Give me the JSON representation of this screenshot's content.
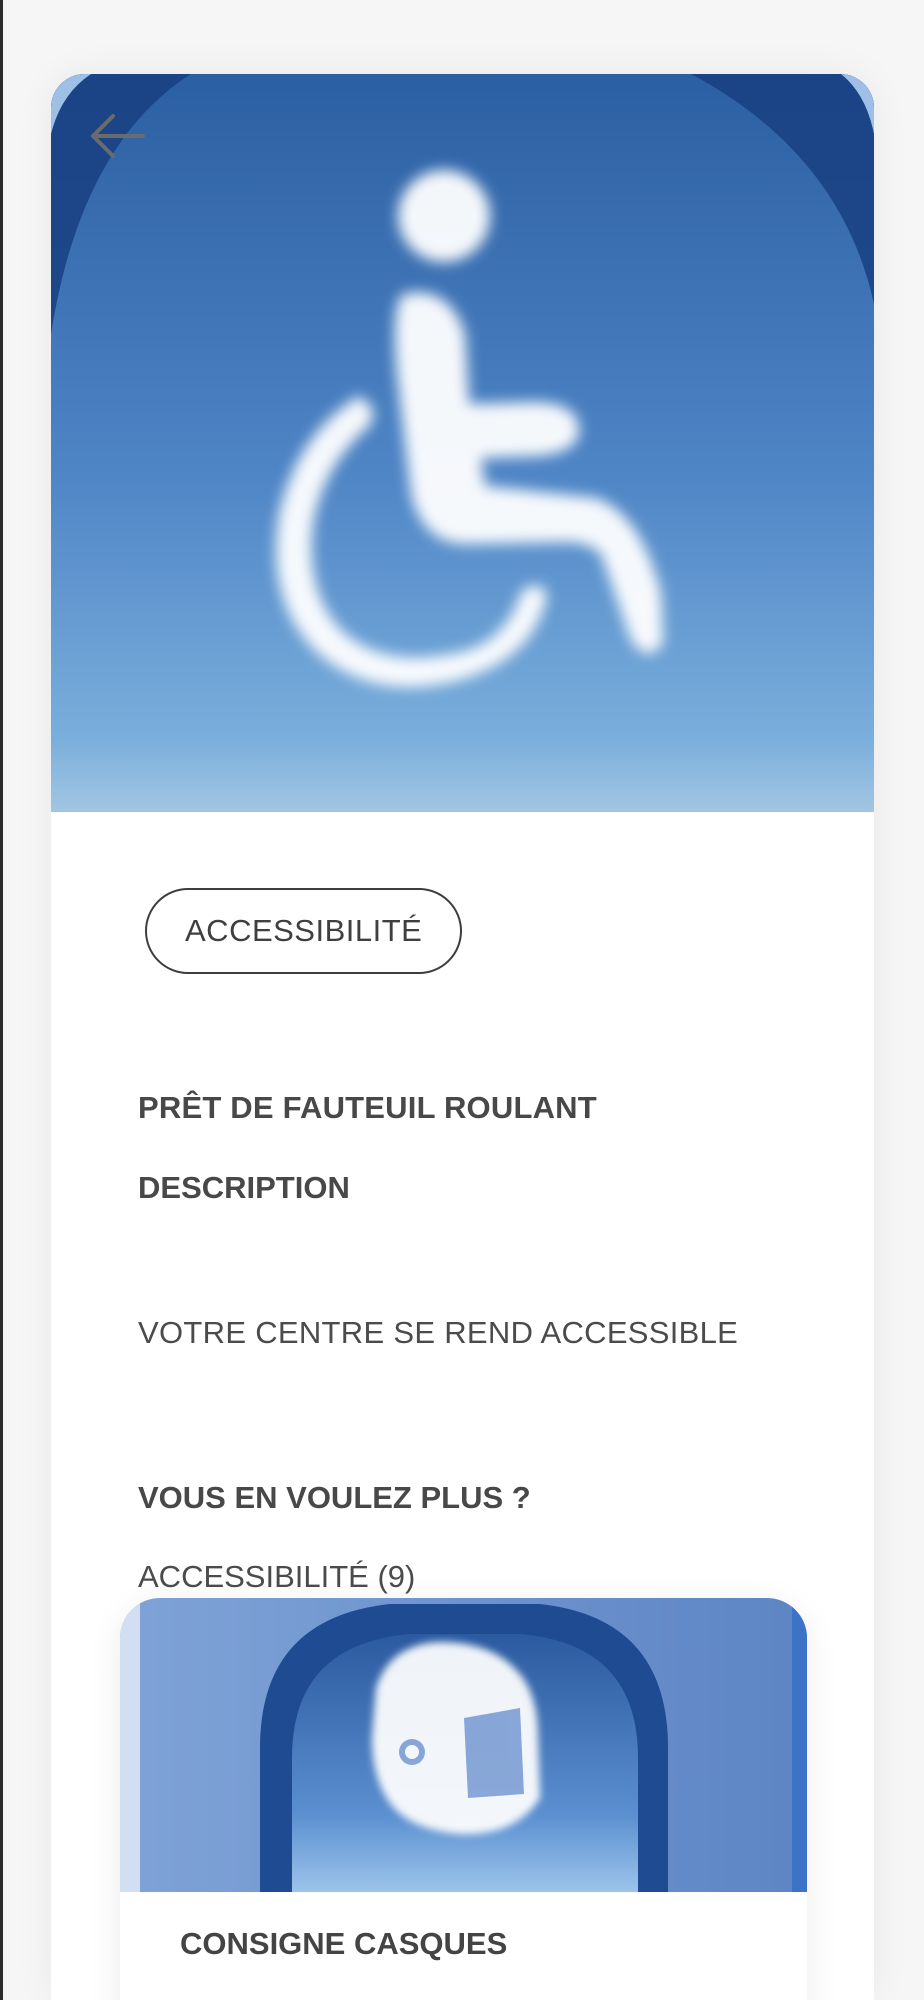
{
  "header": {
    "back_icon": "arrow-left-icon",
    "hero_image": "wheelchair-cloud-sky-image"
  },
  "item": {
    "category": "ACCESSIBILITÉ",
    "title": "PRÊT DE FAUTEUIL ROULANT",
    "description_heading": "DESCRIPTION",
    "description_text": "VOTRE CENTRE SE REND ACCESSIBLE"
  },
  "more": {
    "heading": "VOUS EN VOULEZ PLUS ?",
    "link_label": "ACCESSIBILITÉ (9)"
  },
  "related": [
    {
      "title": "CONSIGNE CASQUES",
      "image": "helmet-cloud-arch-image"
    }
  ],
  "colors": {
    "sky_top": "#2e63a6",
    "sky_bottom": "#8db8df",
    "text": "#484848"
  }
}
